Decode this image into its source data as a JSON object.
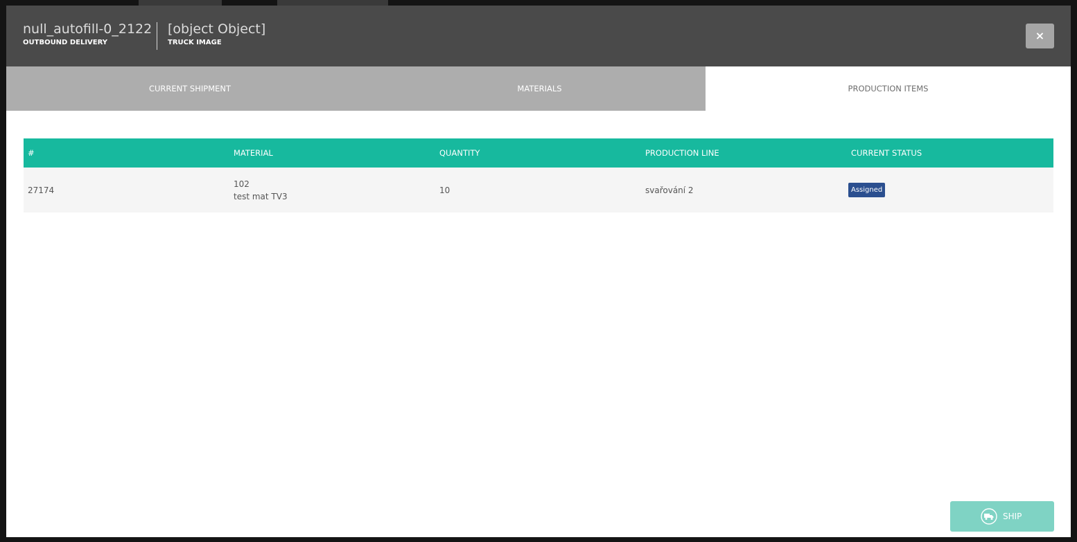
{
  "header": {
    "left_title": "null_autofill-0_2122",
    "left_subtitle": "OUTBOUND DELIVERY",
    "right_title": "[object Object]",
    "right_subtitle": "TRUCK IMAGE",
    "close_label": "×"
  },
  "tabs": [
    {
      "label": "CURRENT SHIPMENT",
      "active": false
    },
    {
      "label": "MATERIALS",
      "active": false
    },
    {
      "label": "PRODUCTION ITEMS",
      "active": true
    }
  ],
  "table": {
    "columns": [
      "#",
      "MATERIAL",
      "QUANTITY",
      "PRODUCTION LINE",
      "CURRENT STATUS"
    ],
    "rows": [
      {
        "id": "27174",
        "material_code": "102",
        "material_name": "test mat TV3",
        "quantity": "10",
        "production_line": "svařování 2",
        "status": "Assigned"
      }
    ]
  },
  "footer": {
    "ship_label": "SHIP",
    "ship_icon": "truck-icon"
  },
  "colors": {
    "header_bg": "#4a4a4a",
    "tab_inactive_bg": "#adadad",
    "table_header_bg": "#17b99e",
    "status_badge_bg": "#2b4f8f",
    "ship_button_bg": "#7fd3c4"
  }
}
